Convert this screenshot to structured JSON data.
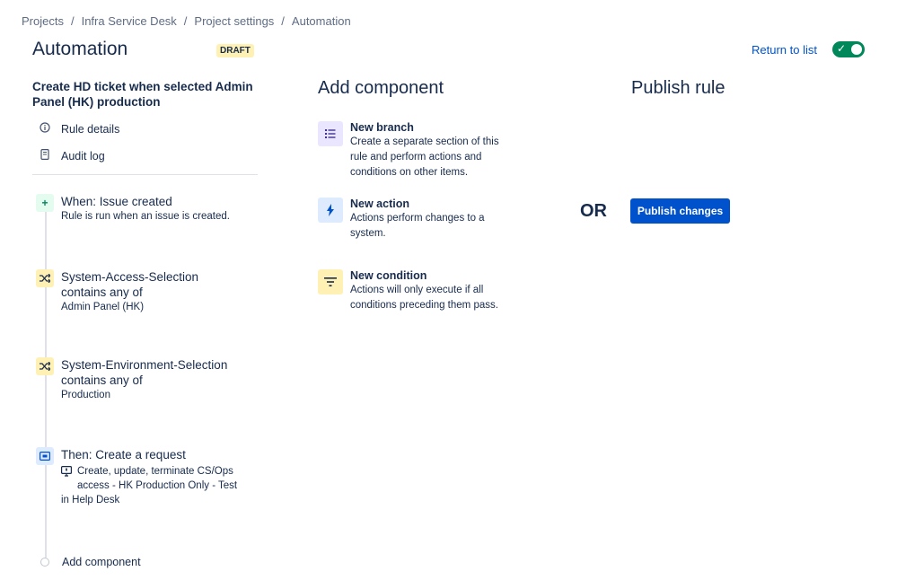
{
  "breadcrumb": [
    "Projects",
    "Infra Service Desk",
    "Project settings",
    "Automation"
  ],
  "breadcrumb_sep": "/",
  "page_title": "Automation",
  "draft_badge": "DRAFT",
  "return_link": "Return to list",
  "toggle": {
    "state": "on",
    "icon": "check-icon",
    "color": "#00875A"
  },
  "rule": {
    "name": "Create HD ticket when selected Admin Panel (HK) production",
    "menu": [
      {
        "label": "Rule details",
        "icon": "info-icon"
      },
      {
        "label": "Audit log",
        "icon": "document-icon"
      }
    ],
    "steps": [
      {
        "title": "When: Issue created",
        "lines": [
          "Rule is run when an issue is created."
        ],
        "icon": "plus-icon"
      },
      {
        "title": "System-Access-Selection",
        "title2": "contains any of",
        "lines": [
          "Admin Panel (HK)"
        ],
        "icon": "shuffle-icon"
      },
      {
        "title": "System-Environment-Selection",
        "title2": "contains any of",
        "lines": [
          "Production"
        ],
        "icon": "shuffle-icon"
      },
      {
        "title": "Then: Create a request",
        "detail1": "Create, update, terminate CS/Ops",
        "detail2": "access - HK Production Only - Test",
        "detail3": "in Help Desk",
        "icon": "request-icon"
      }
    ],
    "add_component": "Add component"
  },
  "add_component_panel": {
    "heading": "Add component",
    "items": [
      {
        "name": "New branch",
        "desc": [
          "Create a separate section of this",
          "rule and perform actions and",
          "conditions on other items."
        ],
        "icon": "list-icon"
      },
      {
        "name": "New action",
        "desc": [
          "Actions perform changes to a",
          "system."
        ],
        "icon": "lightning-icon"
      },
      {
        "name": "New condition",
        "desc": [
          "Actions will only execute if all",
          "conditions preceding them pass."
        ],
        "icon": "filter-icon"
      }
    ]
  },
  "or_label": "OR",
  "publish": {
    "heading": "Publish rule",
    "button": "Publish changes",
    "color": "#0052CC"
  }
}
